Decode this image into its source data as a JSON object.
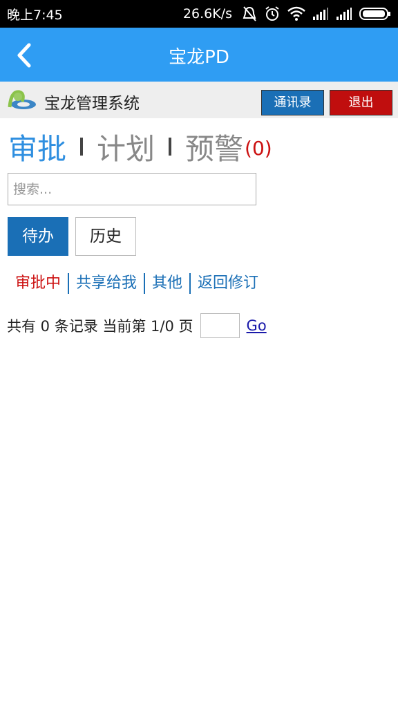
{
  "status_bar": {
    "time": "晚上7:45",
    "speed": "26.6K/s",
    "icons": [
      "mute-bell-icon",
      "alarm-icon",
      "wifi-icon",
      "signal-icon",
      "signal-icon",
      "battery-icon"
    ]
  },
  "header": {
    "title": "宝龙PD",
    "back_icon": "chevron-left-icon"
  },
  "system": {
    "name": "宝龙管理系统",
    "contacts_label": "通讯录",
    "logout_label": "退出"
  },
  "tabs": {
    "approve": "审批",
    "plan": "计划",
    "warning": "预警",
    "warning_count": "(0)"
  },
  "search": {
    "placeholder": "搜索..."
  },
  "subtabs": {
    "pending": "待办",
    "history": "历史"
  },
  "filters": [
    "审批中",
    "共享给我",
    "其他",
    "返回修订"
  ],
  "pager": {
    "summary": "共有 0 条记录 当前第 1/0 页",
    "go_label": "Go"
  },
  "colors": {
    "primary": "#2f9df3",
    "button_blue": "#1a6fb6",
    "button_red": "#c00e0e",
    "alert_red": "#cc1111"
  }
}
